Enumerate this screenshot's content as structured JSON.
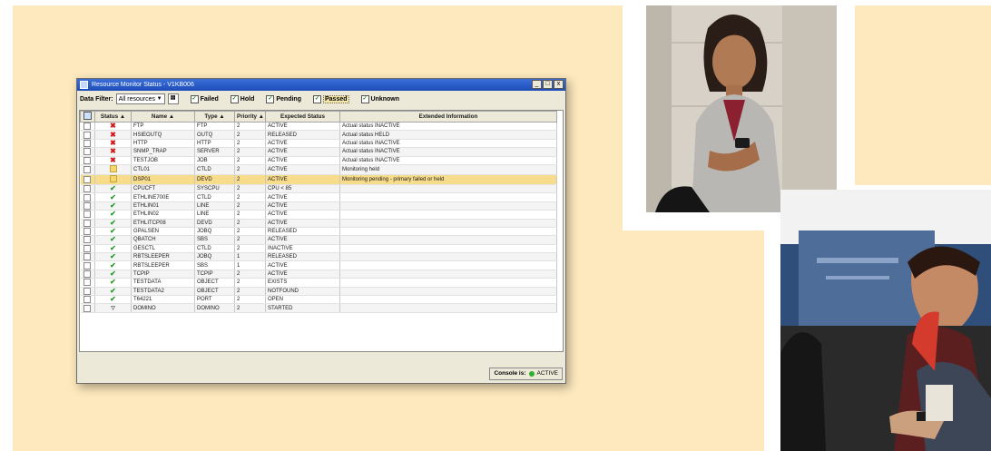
{
  "window": {
    "title": "Resource Monitor Status - V1KB006",
    "controls": {
      "minimize": "_",
      "maximize": "□",
      "close": "x"
    }
  },
  "toolbar": {
    "filter_label": "Data Filter:",
    "filter_value": "All resources",
    "filter_arrow": "▼",
    "checkboxes": [
      {
        "label": "Failed",
        "checked": true
      },
      {
        "label": "Hold",
        "checked": true
      },
      {
        "label": "Pending",
        "checked": true
      },
      {
        "label": "Passed",
        "checked": true
      },
      {
        "label": "Unknown",
        "checked": true
      }
    ]
  },
  "table": {
    "headers": [
      "Status ▲",
      "Name ▲",
      "Type ▲",
      "Priority ▲",
      "Expected Status",
      "Extended Information"
    ],
    "rows": [
      {
        "status": "failed",
        "name": "FTP",
        "type": "FTP",
        "priority": "2",
        "expected": "ACTIVE",
        "info": "Actual status INACTIVE"
      },
      {
        "status": "failed",
        "name": "HSIEOUTQ",
        "type": "OUTQ",
        "priority": "2",
        "expected": "RELEASED",
        "info": "Actual status HELD"
      },
      {
        "status": "failed",
        "name": "HTTP",
        "type": "HTTP",
        "priority": "2",
        "expected": "ACTIVE",
        "info": "Actual status INACTIVE"
      },
      {
        "status": "failed",
        "name": "SNMP_TRAP",
        "type": "SERVER",
        "priority": "2",
        "expected": "ACTIVE",
        "info": "Actual status INACTIVE"
      },
      {
        "status": "failed",
        "name": "TESTJOB",
        "type": "JOB",
        "priority": "2",
        "expected": "ACTIVE",
        "info": "Actual status INACTIVE"
      },
      {
        "status": "pending",
        "name": "CTL01",
        "type": "CTLD",
        "priority": "2",
        "expected": "ACTIVE",
        "info": "Monitoring held"
      },
      {
        "status": "pending",
        "name": "DSP01",
        "type": "DEVD",
        "priority": "2",
        "expected": "ACTIVE",
        "info": "Monitoring pending - primary failed or held"
      },
      {
        "status": "passed",
        "name": "CPUCFT",
        "type": "SYSCPU",
        "priority": "2",
        "expected": "CPU < 85",
        "info": ""
      },
      {
        "status": "passed",
        "name": "ETHLINE700E",
        "type": "CTLD",
        "priority": "2",
        "expected": "ACTIVE",
        "info": ""
      },
      {
        "status": "passed",
        "name": "ETHLIN01",
        "type": "LINE",
        "priority": "2",
        "expected": "ACTIVE",
        "info": ""
      },
      {
        "status": "passed",
        "name": "ETHLIN02",
        "type": "LINE",
        "priority": "2",
        "expected": "ACTIVE",
        "info": ""
      },
      {
        "status": "passed",
        "name": "ETHLITCP08",
        "type": "DEVD",
        "priority": "2",
        "expected": "ACTIVE",
        "info": ""
      },
      {
        "status": "passed",
        "name": "GPALSEN",
        "type": "JOBQ",
        "priority": "2",
        "expected": "RELEASED",
        "info": ""
      },
      {
        "status": "passed",
        "name": "QBATCH",
        "type": "SBS",
        "priority": "2",
        "expected": "ACTIVE",
        "info": ""
      },
      {
        "status": "passed",
        "name": "GESCTL",
        "type": "CTLD",
        "priority": "2",
        "expected": "INACTIVE",
        "info": ""
      },
      {
        "status": "passed",
        "name": "RBTSLEEPER",
        "type": "JOBQ",
        "priority": "1",
        "expected": "RELEASED",
        "info": ""
      },
      {
        "status": "passed",
        "name": "RBTSLEEPER",
        "type": "SBS",
        "priority": "1",
        "expected": "ACTIVE",
        "info": ""
      },
      {
        "status": "passed",
        "name": "TCPIP",
        "type": "TCPIP",
        "priority": "2",
        "expected": "ACTIVE",
        "info": ""
      },
      {
        "status": "passed",
        "name": "TESTDATA",
        "type": "OBJECT",
        "priority": "2",
        "expected": "EXISTS",
        "info": ""
      },
      {
        "status": "passed",
        "name": "TESTDATA2",
        "type": "OBJECT",
        "priority": "2",
        "expected": "NOTFOUND",
        "info": ""
      },
      {
        "status": "passed",
        "name": "T64221",
        "type": "PORT",
        "priority": "2",
        "expected": "OPEN",
        "info": ""
      },
      {
        "status": "unknown",
        "name": "DOMINO",
        "type": "DOMINO",
        "priority": "2",
        "expected": "STARTED",
        "info": ""
      }
    ]
  },
  "status_icons": {
    "failed": "✖",
    "passed": "✔",
    "unknown": "▽"
  },
  "statusbar": {
    "console_label": "Console is:",
    "console_value": "ACTIVE"
  },
  "colors": {
    "background_panel": "#fde9bd",
    "failed": "#d11a1a",
    "passed": "#2b9a2b",
    "highlight_row": "#f7dc8c"
  }
}
